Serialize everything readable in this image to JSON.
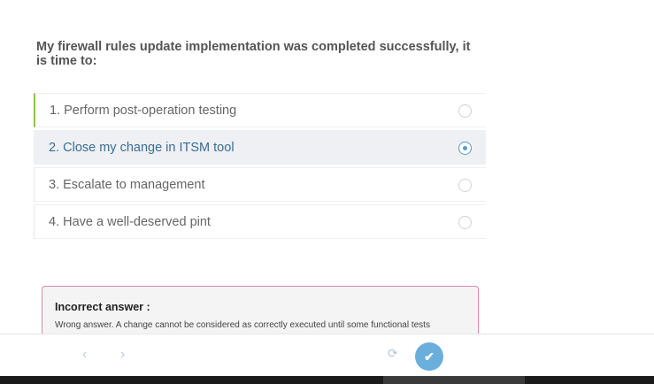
{
  "question": "My firewall rules update implementation was completed successfully, it is time to:",
  "options": [
    {
      "label": "1. Perform post-operation testing",
      "selected": false
    },
    {
      "label": "2. Close my change in ITSM tool",
      "selected": true
    },
    {
      "label": "3. Escalate to management",
      "selected": false
    },
    {
      "label": "4. Have a well-deserved pint",
      "selected": false
    }
  ],
  "feedback": {
    "title": "Incorrect answer :",
    "text": "Wrong answer. A change cannot be considered as correctly executed until some functional tests"
  },
  "nav": {
    "prev_icon": "‹",
    "next_icon": "›",
    "reload_icon": "⟳",
    "submit_icon": "✔"
  },
  "colors": {
    "accent": "#6aaedc",
    "selected_text": "#3a6d95",
    "first_option_border": "#8bc34a",
    "feedback_border": "#d98aa0"
  }
}
